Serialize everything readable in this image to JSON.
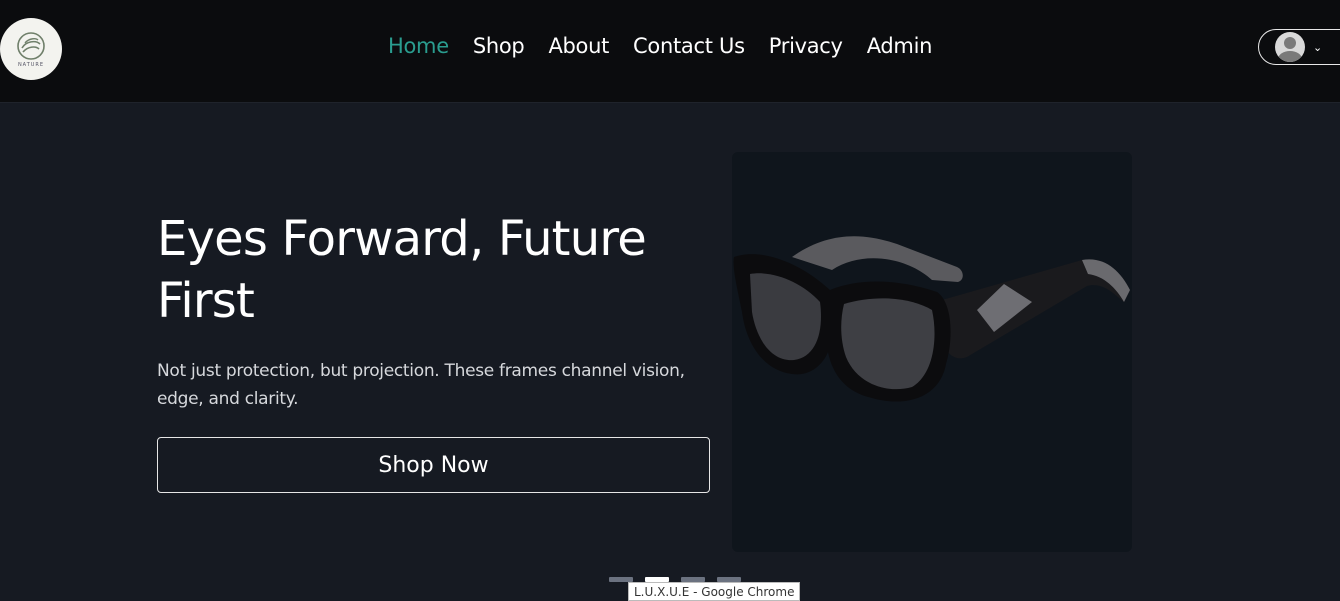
{
  "header": {
    "logo_text": "NATURE",
    "nav": [
      {
        "label": "Home",
        "active": true
      },
      {
        "label": "Shop",
        "active": false
      },
      {
        "label": "About",
        "active": false
      },
      {
        "label": "Contact Us",
        "active": false
      },
      {
        "label": "Privacy",
        "active": false
      },
      {
        "label": "Admin",
        "active": false
      }
    ],
    "user_menu": {
      "avatar_icon": "user-avatar-icon",
      "chevron_icon": "chevron-down-icon"
    }
  },
  "hero": {
    "title": "Eyes Forward, Future First",
    "subtitle": "Not just protection, but projection. These frames channel vision, edge, and clarity.",
    "button_label": "Shop Now",
    "image": "sunglasses"
  },
  "carousel": {
    "count": 4,
    "active_index": 1
  },
  "tooltip": {
    "text": "L.U.X.U.E - Google Chrome"
  },
  "colors": {
    "accent": "#2a9d8f",
    "background": "#161a22",
    "navbar": "#0b0c0e"
  }
}
